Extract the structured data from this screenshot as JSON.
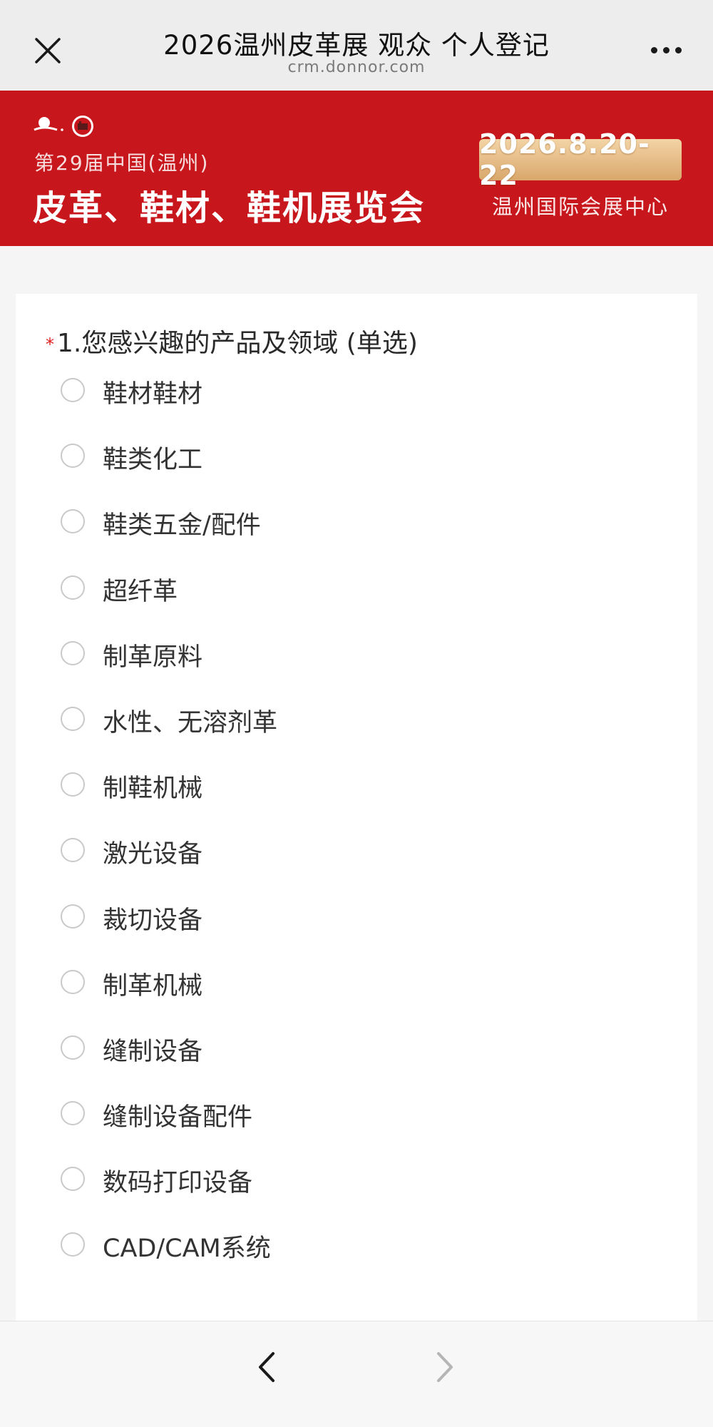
{
  "nav": {
    "title": "2026温州皮革展 观众 个人登记",
    "subtitle": "crm.donnor.com",
    "close_icon": "close-icon",
    "more_icon": "more-icon"
  },
  "banner": {
    "edition": "第29届中国(温州)",
    "expo_name": "皮革、鞋材、鞋机展览会",
    "date": "2026.8.20-22",
    "venue": "温州国际会展中心",
    "background_color": "#c8161d"
  },
  "form": {
    "required_mark": "*",
    "question": "1.您感兴趣的产品及领域 (单选)",
    "options": [
      "鞋材鞋材",
      "鞋类化工",
      "鞋类五金/配件",
      "超纤革",
      "制革原料",
      "水性、无溶剂革",
      "制鞋机械",
      "激光设备",
      "裁切设备",
      "制革机械",
      "缝制设备",
      "缝制设备配件",
      "数码打印设备",
      "CAD/CAM系统"
    ]
  },
  "bottom": {
    "back_icon": "chevron-left-icon",
    "forward_icon": "chevron-right-icon"
  }
}
